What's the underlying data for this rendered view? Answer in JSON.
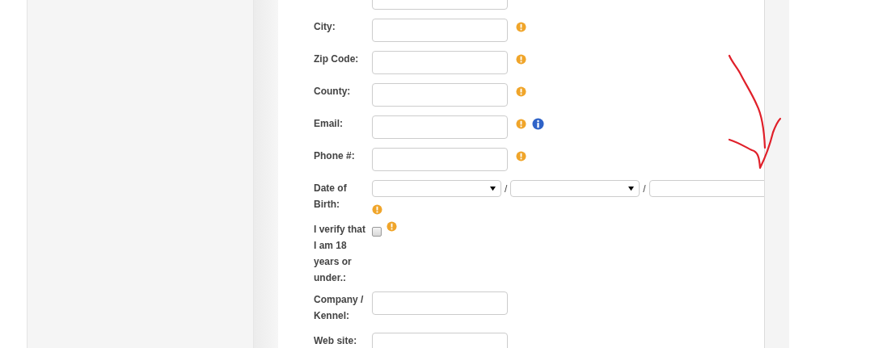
{
  "form": {
    "fields": [
      {
        "kind": "text",
        "required": false,
        "info": false
      },
      {
        "kind": "text",
        "label": "City:",
        "required": true,
        "info": false
      },
      {
        "kind": "text",
        "label": "Zip Code:",
        "required": true,
        "info": false
      },
      {
        "kind": "text",
        "label": "County:",
        "required": true,
        "info": false
      },
      {
        "kind": "text",
        "label": "Email:",
        "required": true,
        "info": true
      },
      {
        "kind": "text",
        "label": "Phone #:",
        "required": true,
        "info": false
      },
      {
        "kind": "date",
        "label": "Date of Birth:",
        "separators": [
          "/",
          "/"
        ],
        "required": true,
        "info": false
      },
      {
        "kind": "checkbox",
        "label": "I verify that I am 18 years or under.:",
        "checked": false,
        "required": true,
        "info": false
      },
      {
        "kind": "text",
        "label": "Company / Kennel:",
        "required": false,
        "info": false
      },
      {
        "kind": "text",
        "label": "Web site:",
        "required": false,
        "info": false
      }
    ]
  }
}
